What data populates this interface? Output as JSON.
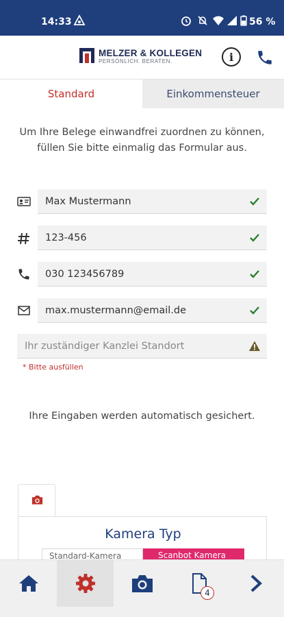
{
  "status_bar": {
    "time": "14:33",
    "battery": "56 %"
  },
  "header": {
    "logo_title": "MELZER & KOLLEGEN",
    "logo_subtitle": "PERSÖNLICH. BERATEN.",
    "info_label": "i",
    "brand_color": "#1f3e7c"
  },
  "tabs": [
    {
      "label": "Standard",
      "active": true
    },
    {
      "label": "Einkommensteuer",
      "active": false
    }
  ],
  "intro_text": "Um Ihre Belege einwandfrei zuordnen zu können, füllen Sie bitte einmalig das Formular aus.",
  "form": {
    "name": {
      "value": "Max Mustermann",
      "icon": "id-card-icon",
      "valid": true
    },
    "number": {
      "value": "123-456",
      "icon": "hash-icon",
      "valid": true
    },
    "phone": {
      "value": "030 123456789",
      "icon": "phone-icon",
      "valid": true
    },
    "email": {
      "value": "max.mustermann@email.de",
      "icon": "mail-icon",
      "valid": true
    },
    "location": {
      "placeholder": "Ihr zuständiger Kanzlei Standort",
      "value": "",
      "valid": false
    },
    "required_hint": "* Bitte ausfüllen"
  },
  "autosave_note": "Ihre Eingaben werden automatisch gesichert.",
  "camera": {
    "title": "Kamera Typ",
    "options": [
      "Standard-Kamera",
      "Scanbot Kamera"
    ],
    "accent_color": "#e0286c"
  },
  "bottom_nav": {
    "items": [
      "home-icon",
      "settings-icon",
      "camera-icon",
      "document-icon",
      "chevron-right-icon"
    ],
    "document_badge": "4"
  }
}
